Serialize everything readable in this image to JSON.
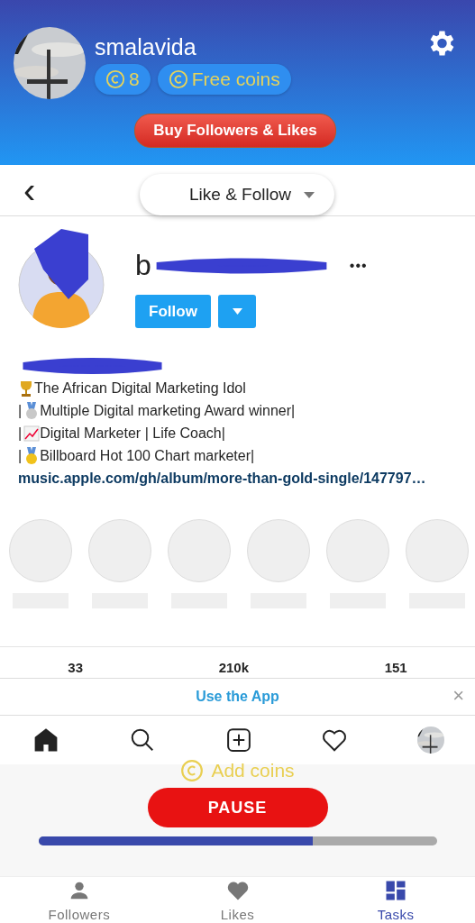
{
  "header": {
    "username": "smalavida",
    "coins": "8",
    "free_coins": "Free coins",
    "buy_button": "Buy Followers & Likes"
  },
  "nav": {
    "back": "‹",
    "mode": "Like & Follow"
  },
  "profile": {
    "name_start": "b",
    "follow": "Follow",
    "more": "•••",
    "bio": [
      {
        "kind": "trophy",
        "text": "The African Digital Marketing Idol"
      },
      {
        "lead": "|",
        "kind": "medal2",
        "text": "Multiple Digital marketing Award winner|"
      },
      {
        "lead": "|",
        "kind": "chart",
        "text": "Digital Marketer | Life Coach|"
      },
      {
        "lead": "|",
        "kind": "medal1",
        "text": "Billboard Hot 100 Chart marketer|"
      }
    ],
    "link": "music.apple.com/gh/album/more-than-gold-single/147797…"
  },
  "highlights": [
    {
      "kind": "placeholder"
    },
    {
      "kind": "placeholder"
    },
    {
      "kind": "placeholder"
    },
    {
      "kind": "placeholder"
    },
    {
      "kind": "placeholder"
    },
    {
      "kind": "placeholder"
    }
  ],
  "stats": [
    "33",
    "210k",
    "151"
  ],
  "banner": {
    "text": "Use the App",
    "close": "×"
  },
  "ig_nav": [
    {
      "kind": "home",
      "selected": true
    },
    {
      "kind": "search",
      "selected": false
    },
    {
      "kind": "add",
      "selected": false
    },
    {
      "kind": "heart",
      "selected": false
    },
    {
      "kind": "avatar",
      "selected": false
    }
  ],
  "task": {
    "add_coins": "Add coins",
    "pause": "PAUSE",
    "level": 0.69
  },
  "tabs": [
    {
      "kind": "person",
      "label": "Followers",
      "selected": false
    },
    {
      "kind": "heart",
      "label": "Likes",
      "selected": false
    },
    {
      "kind": "grid",
      "label": "Tasks",
      "selected": true
    }
  ]
}
